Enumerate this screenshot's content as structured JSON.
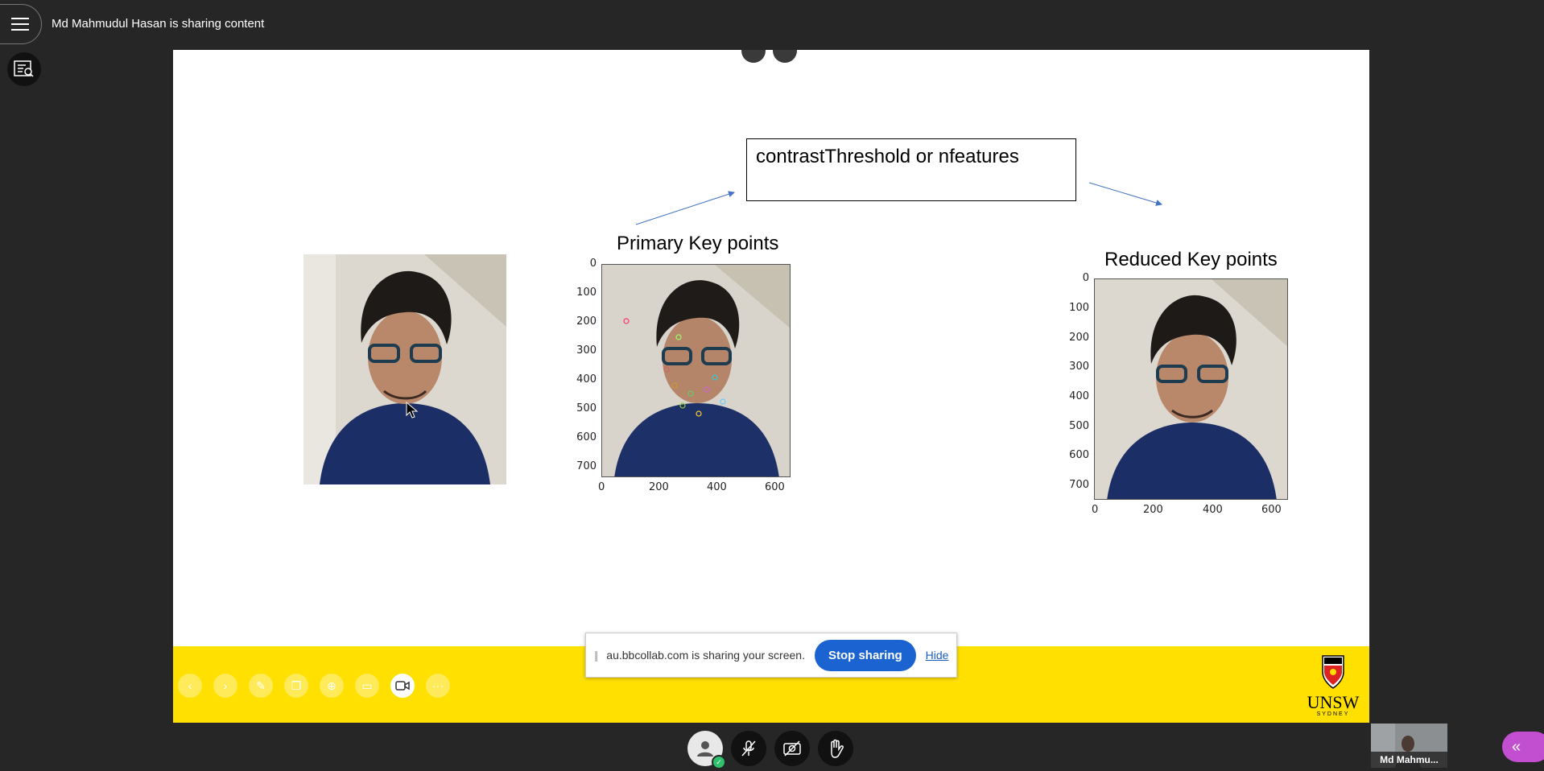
{
  "app": {
    "sharer_text": "Md Mahmudul Hasan is sharing content"
  },
  "slide": {
    "textbox": "contrastThreshold or nfeatures",
    "caption_primary": "Primary Key points",
    "caption_reduced": "Reduced Key points",
    "axis_y_ticks": [
      "0",
      "100",
      "200",
      "300",
      "400",
      "500",
      "600",
      "700"
    ],
    "axis_x_ticks": [
      "0",
      "200",
      "400",
      "600"
    ],
    "logo_text": "UNSW",
    "logo_subtext": "SYDNEY"
  },
  "screen_share_bar": {
    "message": "au.bbcollab.com is sharing your screen.",
    "stop_label": "Stop sharing",
    "hide_label": "Hide"
  },
  "participant": {
    "name": "Md Mahmu..."
  },
  "colors": {
    "background": "#262626",
    "footer_yellow": "#ffe000",
    "stop_button": "#1a63d0",
    "collapse_button": "#c24fcf",
    "status_ok": "#2ec36b"
  },
  "icons": {
    "menu": "hamburger-icon",
    "side": "chat-search-icon",
    "collapse": "double-chevron-left-icon"
  }
}
